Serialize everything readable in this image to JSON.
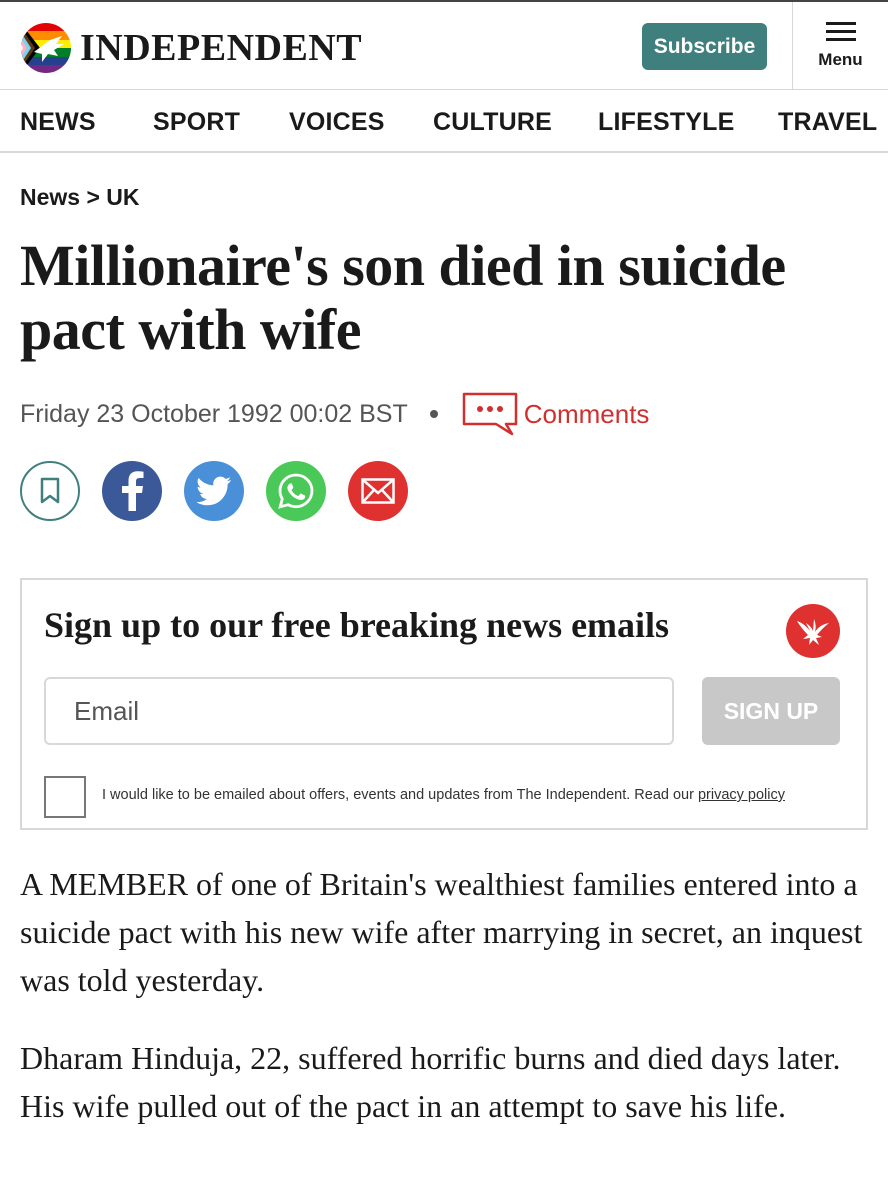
{
  "header": {
    "logo_text": "INDEPENDENT",
    "logo_icon": "eagle-pride-logo",
    "subscribe_label": "Subscribe",
    "menu_label": "Menu",
    "accent_color": "#3f7f7e"
  },
  "nav": {
    "items": [
      "NEWS",
      "SPORT",
      "VOICES",
      "CULTURE",
      "LIFESTYLE",
      "TRAVEL"
    ]
  },
  "breadcrumb": "News > UK",
  "article": {
    "headline": "Millionaire's son died in suicide pact with wife",
    "date": "Friday 23 October 1992 00:02 BST",
    "comments_label": "Comments",
    "paragraphs": [
      "A MEMBER of one of Britain's wealthiest families entered into a suicide pact with his new wife after marrying in secret, an inquest was told yesterday.",
      "Dharam Hinduja, 22, suffered horrific burns and died days later. His wife pulled out of the pact in an attempt to save his life."
    ]
  },
  "share_buttons": [
    {
      "name": "bookmark-icon",
      "color": "#3f7f7e"
    },
    {
      "name": "facebook-icon",
      "color": "#3b5998"
    },
    {
      "name": "twitter-icon",
      "color": "#4a90d9"
    },
    {
      "name": "whatsapp-icon",
      "color": "#4ac959"
    },
    {
      "name": "email-icon",
      "color": "#e03131"
    }
  ],
  "signup": {
    "title": "Sign up to our free breaking news emails",
    "email_placeholder": "Email",
    "button_label": "SIGN UP",
    "consent_text": "I would like to be emailed about offers, events and updates from The Independent. Read our",
    "privacy_link": "privacy policy",
    "emblem_icon": "eagle-icon"
  }
}
